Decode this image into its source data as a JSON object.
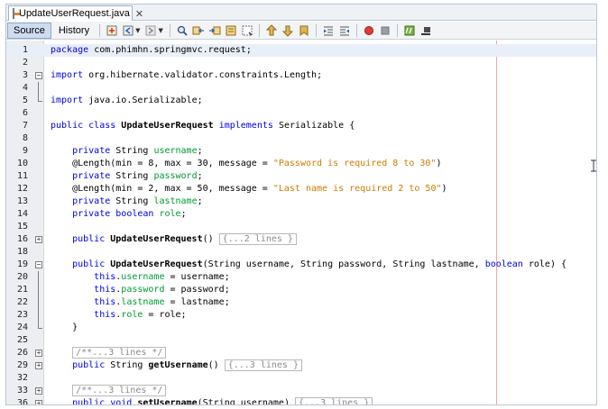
{
  "tab": {
    "title": "UpdateUserRequest.java",
    "close": "✕"
  },
  "toolbar": {
    "source_label": "Source",
    "history_label": "History",
    "icons": [
      "last-edit-icon",
      "back-icon",
      "forward-icon",
      "find-icon",
      "find-previous-icon",
      "find-next-icon",
      "toggle-highlight-icon",
      "toggle-rectangular-icon",
      "previous-bookmark-icon",
      "next-bookmark-icon",
      "toggle-bookmark-icon",
      "shift-left-icon",
      "shift-right-icon",
      "start-macro-icon",
      "stop-macro-icon",
      "comment-icon",
      "uncomment-icon"
    ]
  },
  "editor": {
    "current_line": "1",
    "lines": [
      {
        "n": "1",
        "fold": ""
      },
      {
        "n": "2",
        "fold": ""
      },
      {
        "n": "3",
        "fold": "minus"
      },
      {
        "n": "4",
        "fold": "mid"
      },
      {
        "n": "5",
        "fold": "end"
      },
      {
        "n": "6",
        "fold": ""
      },
      {
        "n": "7",
        "fold": ""
      },
      {
        "n": "8",
        "fold": ""
      },
      {
        "n": "9",
        "fold": ""
      },
      {
        "n": "10",
        "fold": ""
      },
      {
        "n": "11",
        "fold": ""
      },
      {
        "n": "12",
        "fold": ""
      },
      {
        "n": "13",
        "fold": ""
      },
      {
        "n": "14",
        "fold": ""
      },
      {
        "n": "15",
        "fold": ""
      },
      {
        "n": "16",
        "fold": "plus"
      },
      {
        "n": "18",
        "fold": ""
      },
      {
        "n": "19",
        "fold": "minus"
      },
      {
        "n": "20",
        "fold": "mid"
      },
      {
        "n": "21",
        "fold": "mid"
      },
      {
        "n": "22",
        "fold": "mid"
      },
      {
        "n": "23",
        "fold": "mid"
      },
      {
        "n": "24",
        "fold": "end"
      },
      {
        "n": "25",
        "fold": ""
      },
      {
        "n": "26",
        "fold": "plus"
      },
      {
        "n": "29",
        "fold": "plus"
      },
      {
        "n": "32",
        "fold": ""
      },
      {
        "n": "33",
        "fold": "plus"
      },
      {
        "n": "36",
        "fold": "plus"
      }
    ],
    "code": {
      "l1": [
        "package com.phimhn.springmvc.request;"
      ],
      "l3": [
        "import org.hibernate.validator.constraints.Length;"
      ],
      "l5": [
        "import java.io.Serializable;"
      ],
      "l7": [
        "public class ",
        "UpdateUserRequest",
        " implements ",
        "Serializable {"
      ],
      "l9": [
        "    private ",
        "String ",
        "username",
        ";"
      ],
      "l10": [
        "    @Length(min = 8, max = 30, message = ",
        "\"Password is required 8 to 30\"",
        ")"
      ],
      "l11": [
        "    private ",
        "String ",
        "password",
        ";"
      ],
      "l12": [
        "    @Length(min = 2, max = 50, message = ",
        "\"Last name is required 2 to 50\"",
        ")"
      ],
      "l13": [
        "    private ",
        "String ",
        "lastname",
        ";"
      ],
      "l14": [
        "    private boolean ",
        "role",
        ";"
      ],
      "l16": [
        "    public ",
        "UpdateUserRequest",
        "() ",
        "{...2 lines }"
      ],
      "l19": [
        "    public ",
        "UpdateUserRequest",
        "(String username, String password, String lastname, ",
        "boolean",
        " role) {"
      ],
      "l20": [
        "        this.",
        "username",
        " = username;"
      ],
      "l21": [
        "        this.",
        "password",
        " = password;"
      ],
      "l22": [
        "        this.",
        "lastname",
        " = lastname;"
      ],
      "l23": [
        "        this.",
        "role",
        " = role;"
      ],
      "l24": [
        "    }"
      ],
      "l26": [
        "    /**...3 lines */"
      ],
      "l29": [
        "    public String ",
        "getUsername",
        "() ",
        "{...3 lines }"
      ],
      "l33": [
        "    /**...3 lines */"
      ],
      "l36": [
        "    public void ",
        "setUsername",
        "(String username) ",
        "{...3 lines }"
      ]
    }
  }
}
